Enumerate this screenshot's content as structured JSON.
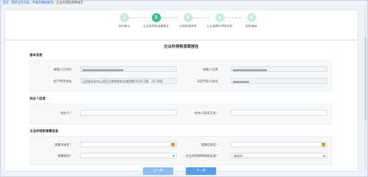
{
  "breadcrumb": {
    "home": "首页",
    "path1": "我的任务列表",
    "path2": "申报及缴纳查询",
    "current": "企业所得税清算报告"
  },
  "steps": [
    {
      "num": "1",
      "label": "身份确认"
    },
    {
      "num": "2",
      "label": "企业所得税清算报告"
    },
    {
      "num": "3",
      "label": "注销税源审核"
    },
    {
      "num": "4",
      "label": "企业清算所得税申报"
    },
    {
      "num": "5",
      "label": "税款缴纳"
    }
  ],
  "active_step": 2,
  "report_title": "企业所得税清算报告",
  "basic_info": {
    "title": "基本信息",
    "taxpayer_id_label": "纳税人识别号",
    "taxpayer_name_label": "纳税人名称",
    "address_label": "生产经营地址",
    "address_value": "山西省长治市上党区太原街铁东北道西路78号B-2楼、12-18室",
    "legal_rep_label": "法定代表人姓名"
  },
  "handler_info": {
    "title": "经办人信息",
    "name_label": "经办人",
    "phone_label": "经办人联系方式"
  },
  "liquidation_info": {
    "title": "企业所得税清算信息",
    "start_label": "清算开始日",
    "end_label": "清算结束日",
    "reason_label": "清算原因",
    "select_placeholder": "-请选择-",
    "special_label": "企业所得税特殊性处理",
    "special_value": "-请选择-"
  },
  "buttons": {
    "prev": "上一步",
    "next": "下一步"
  }
}
